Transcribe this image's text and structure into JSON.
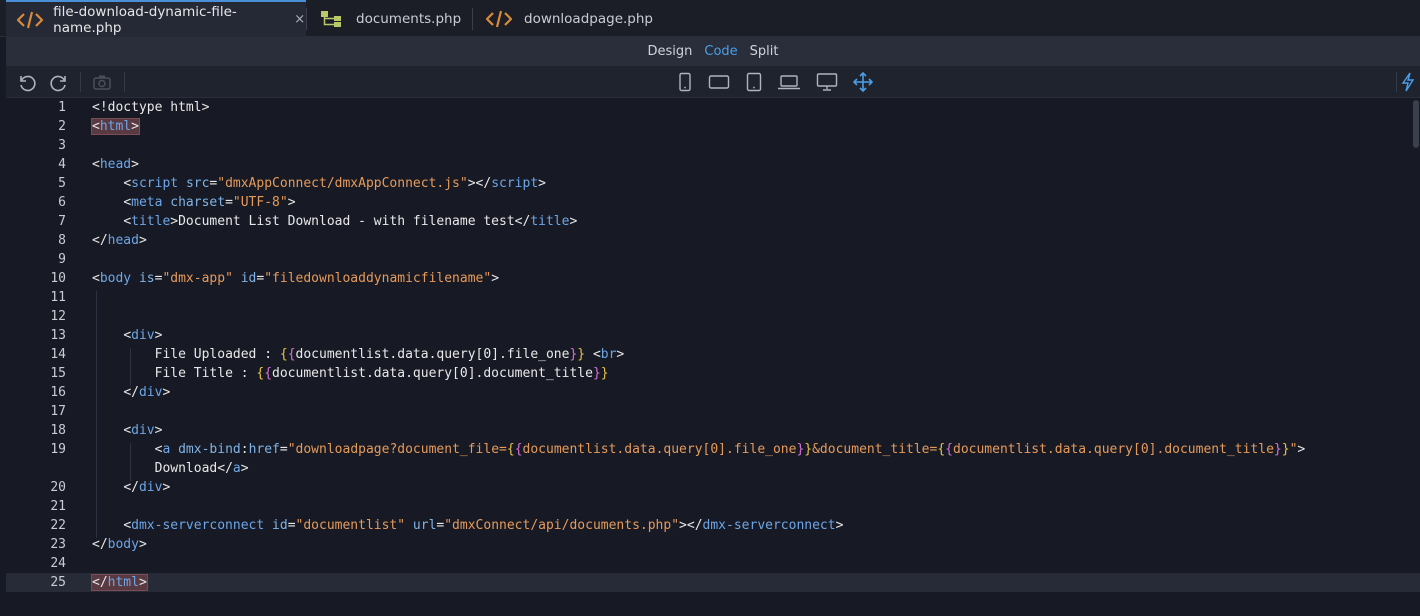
{
  "tabs": [
    {
      "label": "file-download-dynamic-file-name.php",
      "icon": "code-icon",
      "active": true,
      "close": "×"
    },
    {
      "label": "documents.php",
      "icon": "sitemap-icon",
      "active": false
    },
    {
      "label": "downloadpage.php",
      "icon": "code-icon",
      "active": false
    }
  ],
  "modes": [
    "Design",
    "Code",
    "Split"
  ],
  "active_mode": "Code",
  "toolbar": {
    "left": [
      "undo-icon",
      "redo-icon",
      "camera-icon"
    ],
    "devices": [
      "phone-portrait-icon",
      "tablet-landscape-icon",
      "tablet-portrait-icon",
      "laptop-icon",
      "desktop-icon",
      "move-arrows-icon"
    ],
    "right": [
      "lightning-icon"
    ]
  },
  "code": {
    "line_numbers": [
      "1",
      "2",
      "3",
      "4",
      "5",
      "6",
      "7",
      "8",
      "9",
      "10",
      "11",
      "12",
      "13",
      "14",
      "15",
      "16",
      "17",
      "18",
      "19",
      "",
      "20",
      "21",
      "22",
      "23",
      "24",
      "25"
    ],
    "current_line": "25",
    "lines": {
      "l1": "<!doctype html>",
      "l5_src": "\"dmxAppConnect/dmxAppConnect.js\"",
      "l6_charset": "\"UTF-8\"",
      "l7_title": "Document List Download - with filename test",
      "l10_is": "\"dmx-app\"",
      "l10_id": "\"filedownloaddynamicfilename\"",
      "l14_text": "File Uploaded : ",
      "l14_expr": "documentlist.data.query[0].file_one",
      "l15_text": "File Title : ",
      "l15_expr": "documentlist.data.query[0].document_title",
      "l19_href_pre": "\"downloadpage?document_file=",
      "l19_expr1": "documentlist.data.query[0].file_one",
      "l19_mid": "&document_title=",
      "l19_expr2": "documentlist.data.query[0].document_title",
      "l19b_text": "Download",
      "l22_id": "\"documentlist\"",
      "l22_url": "\"dmxConnect/api/documents.php\""
    }
  }
}
